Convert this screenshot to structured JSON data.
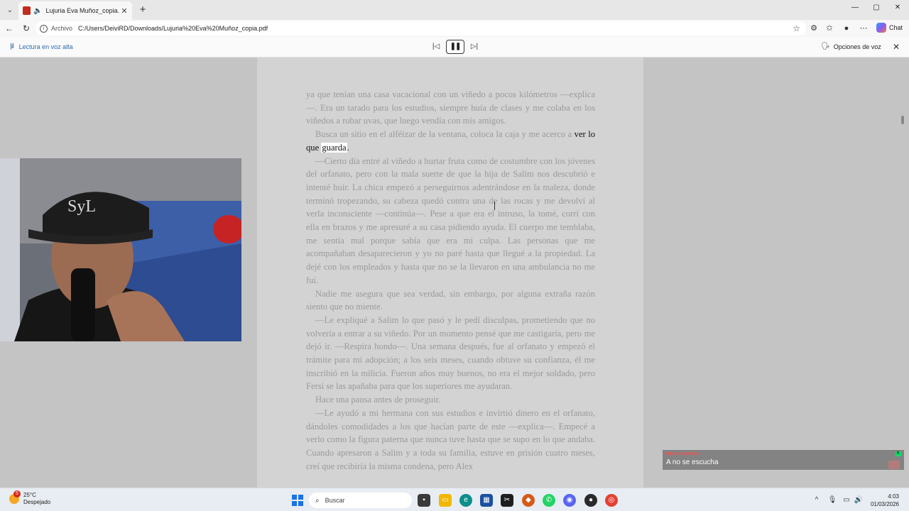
{
  "browser": {
    "tab_title": "Lujuria Eva Muñoz_copia.pdf",
    "scheme_label": "Archivo",
    "url": "C:/Users/DeiviRD/Downloads/Lujuria%20Eva%20Muñoz_copia.pdf",
    "copilot_label": "Chat",
    "window_controls": [
      "—",
      "▢",
      "✕"
    ]
  },
  "read_aloud": {
    "title": "Lectura en voz alta",
    "voice_options": "Opciones de voz"
  },
  "document": {
    "paragraphs": [
      {
        "indent": false,
        "before": "ya que tenían una casa vacacional con un viñedo a pocos kilómetros —explica—. Era un tarado para los estudios, siempre huía de clases y me colaba en los viñedos a robar uvas, que luego vendía con mis amigos.",
        "highlight": "",
        "word": "",
        "after": ""
      },
      {
        "indent": true,
        "before": "Busca un sitio en el alféizar de la ventana, coloca la caja y me acerco a ",
        "highlight": "ver lo que ",
        "word": "guarda",
        "after": "."
      },
      {
        "indent": true,
        "before": "—Cierto día entré al viñedo a hurtar fruta como de costumbre con los jóvenes del orfanato, pero con la mala suerte de que la hija de Salim nos descubrió e intenté huir. La chica empezó a perseguirnos adentrándose en la maleza, donde terminó tropezando, su cabeza quedó contra una de las rocas y me devolví al verla inconsciente —continúa—. Pese a que era el intruso, la tomé, corrí con ella en brazos y me apresuré a su casa pidiendo ayuda. El cuerpo me temblaba, me sentía mal porque sabía que era mi culpa. Las personas que me acompañaban desaparecieron y yo no paré hasta que llegué a la propiedad. La dejé con los empleados y hasta que no se la llevaron en una ambulancia no me fui.",
        "highlight": "",
        "word": "",
        "after": ""
      },
      {
        "indent": true,
        "before": "Nadie me asegura que sea verdad, sin embargo, por alguna extraña razón siento que no miente.",
        "highlight": "",
        "word": "",
        "after": ""
      },
      {
        "indent": true,
        "before": "—Le expliqué a Salim lo que pasó y le pedí disculpas, prometiendo que no volvería a entrar a su viñedo. Por un momento pensé que me castigaría, pero me dejó ir. —Respira hondo—. Una semana después, fue al orfanato y empezó el trámite para mi adopción; a los seis meses, cuando obtuve su confianza, él me inscribió en la milicia. Fueron años muy buenos, no era el mejor soldado, pero Fersi se las apañaba para que los superiores me ayudaran.",
        "highlight": "",
        "word": "",
        "after": ""
      },
      {
        "indent": true,
        "before": "Hace una pausa antes de proseguir.",
        "highlight": "",
        "word": "",
        "after": ""
      },
      {
        "indent": true,
        "before": "—Le ayudó a mi hermana con sus estudios e invirtió dinero en el orfanato, dándoles comodidades a los que hacían parte de este —explica—. Empecé a verlo como la figura paterna que nunca tuve hasta que se supo en lo que andaba. Cuando apresaron a Salim y a toda su familia, estuve en prisión cuatro meses, creí que recibiría la misma condena, pero Alex",
        "highlight": "",
        "word": "",
        "after": ""
      }
    ]
  },
  "chat": {
    "username": "MELLITAMONTES",
    "message": "A no se escucha",
    "badge": "K"
  },
  "taskbar": {
    "weather_temp": "25°C",
    "weather_desc": "Despejado",
    "weather_badge": "5",
    "search_placeholder": "Buscar",
    "time": "4:03",
    "date": "01/03/2026"
  },
  "colors": {
    "accent": "#2b6ab0",
    "pdf_red": "#c42b1c",
    "page_bg": "#d3d3d3",
    "viewer_bg": "#c4c4c4"
  }
}
